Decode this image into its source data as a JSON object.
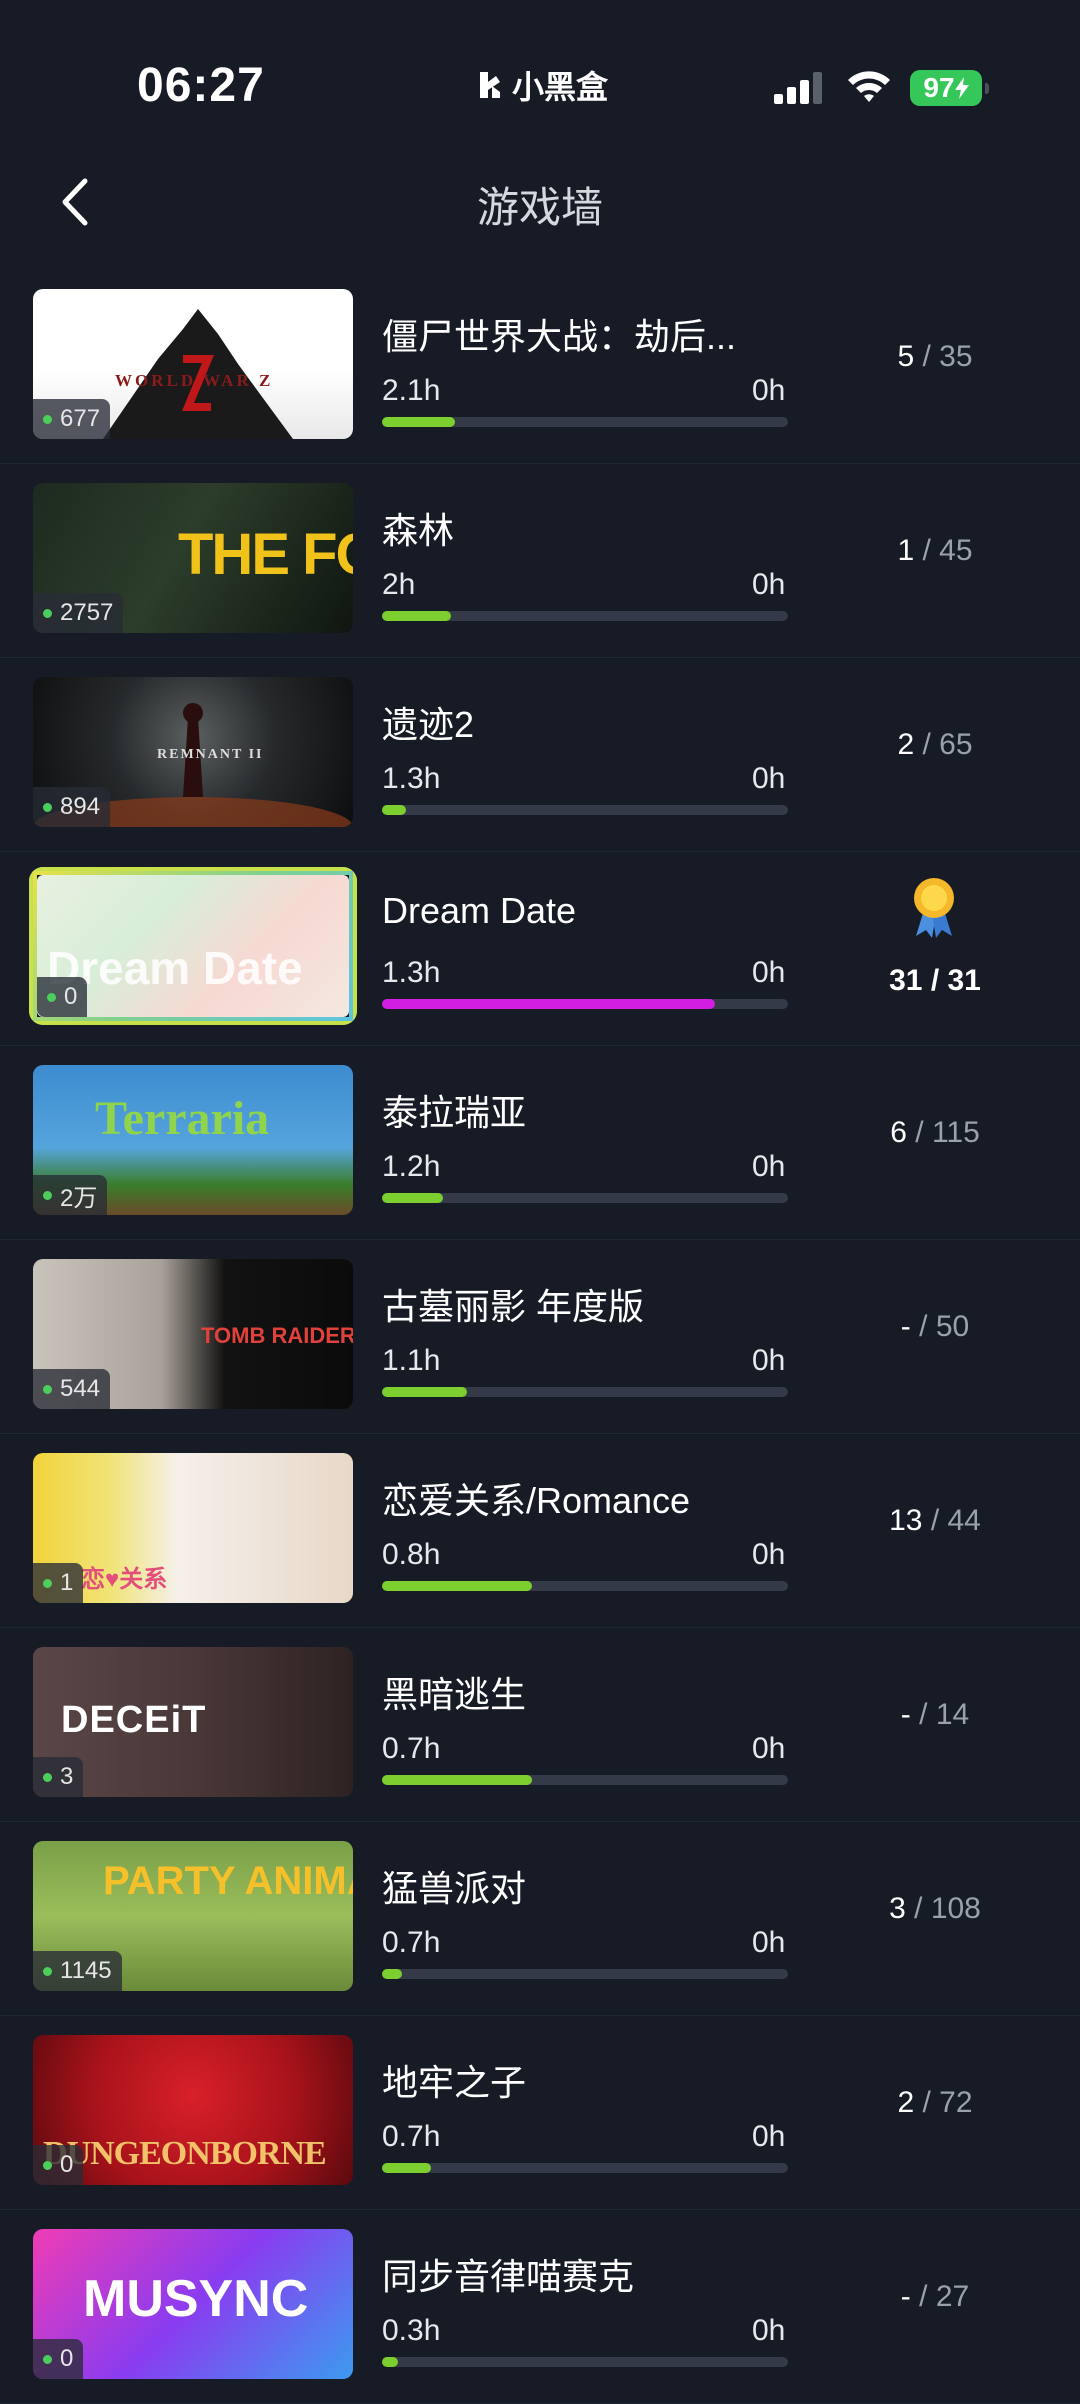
{
  "status_bar": {
    "time": "06:27",
    "carrier": "小黑盒",
    "battery": "97"
  },
  "nav": {
    "title": "游戏墙"
  },
  "games": [
    {
      "title": "僵尸世界大战：劫后...",
      "played": "2.1h",
      "recent": "0h",
      "progress": 0.18,
      "ach_got": "5",
      "ach_total": "35",
      "owners": "677",
      "cover_text": "WORLD WAR Z",
      "complete": false
    },
    {
      "title": "森林",
      "played": "2h",
      "recent": "0h",
      "progress": 0.17,
      "ach_got": "1",
      "ach_total": "45",
      "owners": "2757",
      "cover_text": "THE FOREST",
      "complete": false
    },
    {
      "title": "遗迹2",
      "played": "1.3h",
      "recent": "0h",
      "progress": 0.06,
      "ach_got": "2",
      "ach_total": "65",
      "owners": "894",
      "cover_text": "REMNANT II",
      "complete": false
    },
    {
      "title": "Dream Date",
      "played": "1.3h",
      "recent": "0h",
      "progress": 0.82,
      "ach_got": "31",
      "ach_total": "31",
      "owners": "0",
      "cover_text": "Dream Date",
      "complete": true
    },
    {
      "title": "泰拉瑞亚",
      "played": "1.2h",
      "recent": "0h",
      "progress": 0.15,
      "ach_got": "6",
      "ach_total": "115",
      "owners": "2万",
      "cover_text": "Terraria",
      "complete": false
    },
    {
      "title": "古墓丽影 年度版",
      "played": "1.1h",
      "recent": "0h",
      "progress": 0.21,
      "ach_got": "-",
      "ach_total": "50",
      "owners": "544",
      "cover_text": "TOMB RAIDER",
      "complete": false
    },
    {
      "title": "恋爱关系/Romance",
      "played": "0.8h",
      "recent": "0h",
      "progress": 0.37,
      "ach_got": "13",
      "ach_total": "44",
      "owners": "1",
      "cover_text": "恋♥关系",
      "complete": false
    },
    {
      "title": "黑暗逃生",
      "played": "0.7h",
      "recent": "0h",
      "progress": 0.37,
      "ach_got": "-",
      "ach_total": "14",
      "owners": "3",
      "cover_text": "DECEiT",
      "complete": false
    },
    {
      "title": "猛兽派对",
      "played": "0.7h",
      "recent": "0h",
      "progress": 0.05,
      "ach_got": "3",
      "ach_total": "108",
      "owners": "1145",
      "cover_text": "PARTY ANIMALS",
      "complete": false
    },
    {
      "title": "地牢之子",
      "played": "0.7h",
      "recent": "0h",
      "progress": 0.12,
      "ach_got": "2",
      "ach_total": "72",
      "owners": "0",
      "cover_text": "DUNGEONBORNE",
      "complete": false
    },
    {
      "title": "同步音律喵赛克",
      "played": "0.3h",
      "recent": "0h",
      "progress": 0.04,
      "ach_got": "-",
      "ach_total": "27",
      "owners": "0",
      "cover_text": "MUSYNC",
      "complete": false
    }
  ],
  "colors": {
    "background": "#161b26",
    "progress": "#7ccf2f",
    "progress_complete": "#d21ee0",
    "battery": "#35c759"
  }
}
